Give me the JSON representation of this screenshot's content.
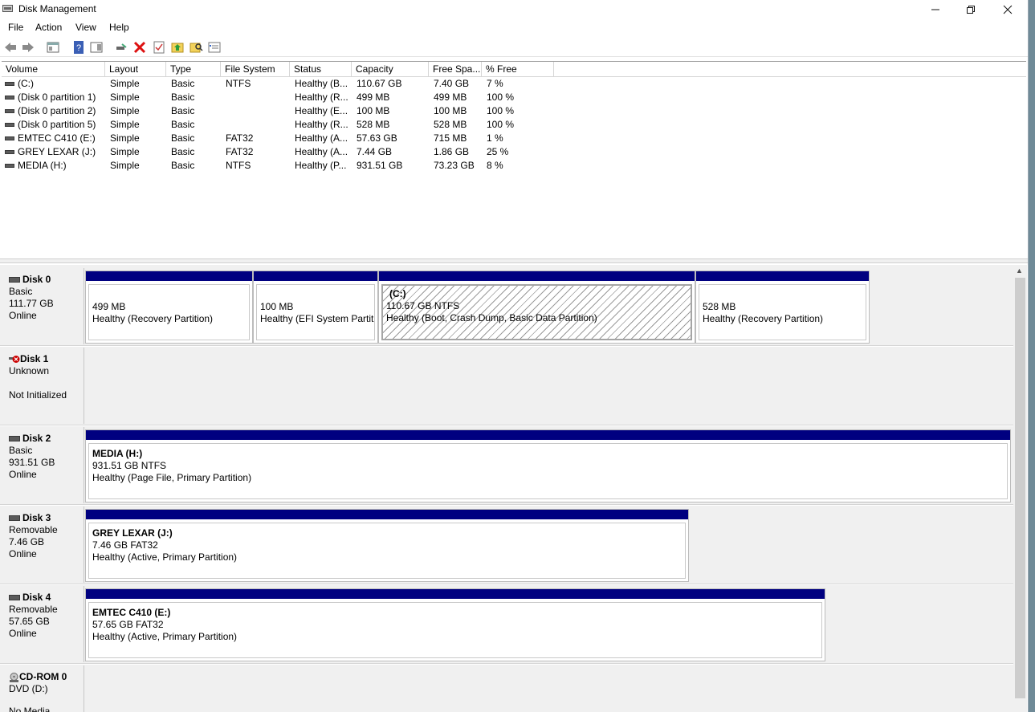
{
  "window": {
    "title": "Disk Management"
  },
  "menu": [
    "File",
    "Action",
    "View",
    "Help"
  ],
  "columns": [
    "Volume",
    "Layout",
    "Type",
    "File System",
    "Status",
    "Capacity",
    "Free Spa...",
    "% Free"
  ],
  "volumes": [
    {
      "volume": " (C:)",
      "layout": "Simple",
      "type": "Basic",
      "fs": "NTFS",
      "status": "Healthy (B...",
      "capacity": "110.67 GB",
      "free": "7.40 GB",
      "pct": "7 %"
    },
    {
      "volume": "(Disk 0 partition 1)",
      "layout": "Simple",
      "type": "Basic",
      "fs": "",
      "status": "Healthy (R...",
      "capacity": "499 MB",
      "free": "499 MB",
      "pct": "100 %"
    },
    {
      "volume": "(Disk 0 partition 2)",
      "layout": "Simple",
      "type": "Basic",
      "fs": "",
      "status": "Healthy (E...",
      "capacity": "100 MB",
      "free": "100 MB",
      "pct": "100 %"
    },
    {
      "volume": "(Disk 0 partition 5)",
      "layout": "Simple",
      "type": "Basic",
      "fs": "",
      "status": "Healthy (R...",
      "capacity": "528 MB",
      "free": "528 MB",
      "pct": "100 %"
    },
    {
      "volume": "EMTEC C410 (E:)",
      "layout": "Simple",
      "type": "Basic",
      "fs": "FAT32",
      "status": "Healthy (A...",
      "capacity": "57.63 GB",
      "free": "715 MB",
      "pct": "1 %"
    },
    {
      "volume": "GREY LEXAR (J:)",
      "layout": "Simple",
      "type": "Basic",
      "fs": "FAT32",
      "status": "Healthy (A...",
      "capacity": "7.44 GB",
      "free": "1.86 GB",
      "pct": "25 %"
    },
    {
      "volume": "MEDIA (H:)",
      "layout": "Simple",
      "type": "Basic",
      "fs": "NTFS",
      "status": "Healthy (P...",
      "capacity": "931.51 GB",
      "free": "73.23 GB",
      "pct": "8 %"
    }
  ],
  "disks": {
    "d0": {
      "name": "Disk 0",
      "kind": "Basic",
      "size": "111.77 GB",
      "state": "Online",
      "p1": {
        "size": "499 MB",
        "status": "Healthy (Recovery Partition)"
      },
      "p2": {
        "size": "100 MB",
        "status": "Healthy (EFI System Partiti"
      },
      "p3": {
        "label": "(C:)",
        "size": "110.67 GB NTFS",
        "status": "Healthy (Boot, Crash Dump, Basic Data Partition)"
      },
      "p4": {
        "size": "528 MB",
        "status": "Healthy (Recovery Partition)"
      }
    },
    "d1": {
      "name": "Disk 1",
      "kind": "Unknown",
      "state": "Not Initialized"
    },
    "d2": {
      "name": "Disk 2",
      "kind": "Basic",
      "size": "931.51 GB",
      "state": "Online",
      "p1": {
        "label": "MEDIA  (H:)",
        "size": "931.51 GB NTFS",
        "status": "Healthy (Page File, Primary Partition)"
      }
    },
    "d3": {
      "name": "Disk 3",
      "kind": "Removable",
      "size": "7.46 GB",
      "state": "Online",
      "p1": {
        "label": "GREY LEXAR  (J:)",
        "size": "7.46 GB FAT32",
        "status": "Healthy (Active, Primary Partition)"
      }
    },
    "d4": {
      "name": "Disk 4",
      "kind": "Removable",
      "size": "57.65 GB",
      "state": "Online",
      "p1": {
        "label": "EMTEC C410  (E:)",
        "size": "57.65 GB FAT32",
        "status": "Healthy (Active, Primary Partition)"
      }
    },
    "cd": {
      "name": "CD-ROM 0",
      "kind": "DVD (D:)",
      "state": "No Media"
    }
  },
  "colors": {
    "partition_bar": "#000080",
    "error_icon": "#cc0000"
  }
}
